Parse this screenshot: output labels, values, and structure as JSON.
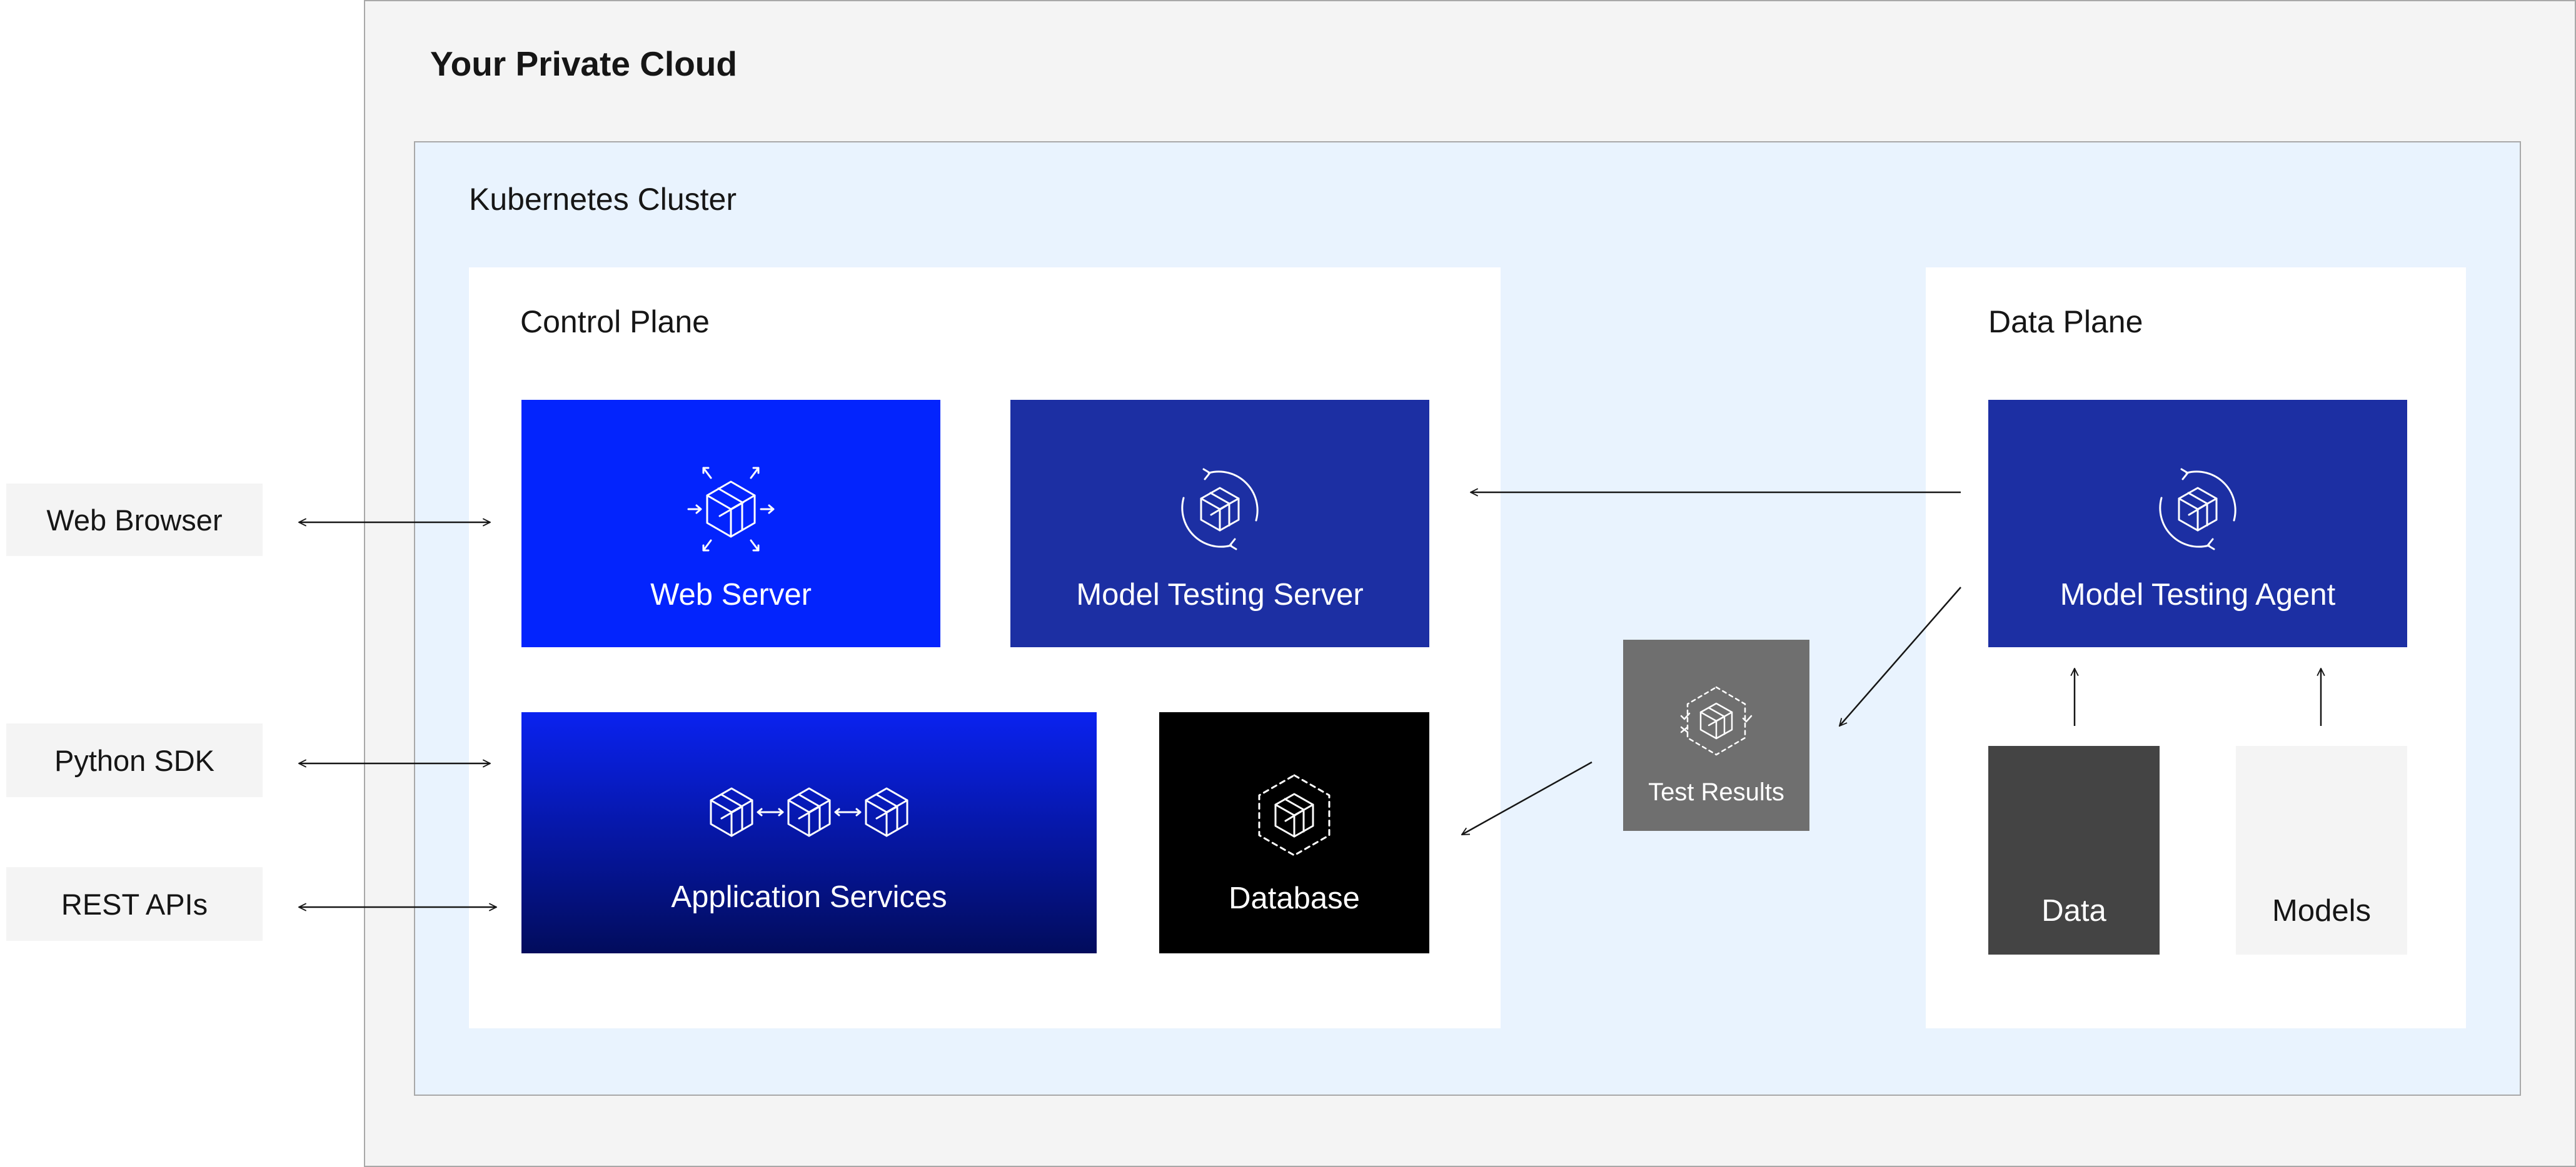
{
  "clients": {
    "web_browser": "Web Browser",
    "python_sdk": "Python SDK",
    "rest_apis": "REST APIs"
  },
  "private_cloud": {
    "title": "Your Private Cloud"
  },
  "kubernetes_cluster": {
    "title": "Kubernetes Cluster"
  },
  "control_plane": {
    "title": "Control Plane",
    "web_server": "Web Server",
    "model_testing_server": "Model Testing Server",
    "application_services": "Application Services",
    "database": "Database"
  },
  "test_results": "Test Results",
  "data_plane": {
    "title": "Data Plane",
    "model_testing_agent": "Model Testing Agent",
    "data": "Data",
    "models": "Models"
  },
  "icons": {
    "web_server": "cube-with-outward-arrows-icon",
    "model_testing_server": "cube-sync-icon",
    "model_testing_agent": "cube-sync-icon",
    "application_services": "linked-cubes-icon",
    "database": "cube-in-dashed-hexagon-icon",
    "test_results": "cube-check-icon"
  },
  "colors": {
    "web_server": "#0324fd",
    "model_testing": "#1c2fa3",
    "app_services_top": "#0a22f0",
    "app_services_bottom": "#020c5c",
    "database": "#000000",
    "test_results": "#6f6f6f",
    "data": "#444444",
    "models": "#f4f4f4",
    "cluster_bg": "#e9f3fe",
    "cloud_bg": "#f4f4f4"
  }
}
